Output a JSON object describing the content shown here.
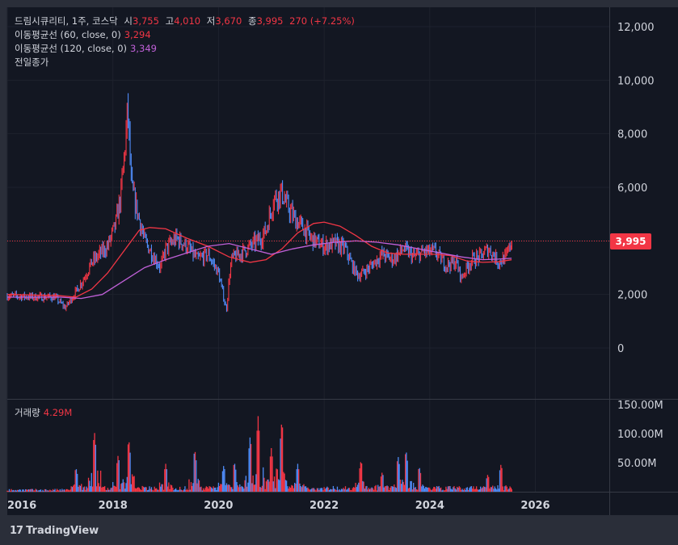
{
  "header": {
    "name": "드림시큐리티, 1주, 코스닥",
    "open_label": "시",
    "open": "3,755",
    "high_label": "고",
    "high": "4,010",
    "low_label": "저",
    "low": "3,670",
    "close_label": "종",
    "close": "3,995",
    "change": "270 (+7.25%)"
  },
  "ma60": {
    "label": "이동평균선 (60, close, 0)",
    "value": "3,294"
  },
  "ma120": {
    "label": "이동평균선 (120, close, 0)",
    "value": "3,349"
  },
  "prev_close_label": "전일종가",
  "last_price_tag": "3,995",
  "volume": {
    "label": "거래량",
    "value": "4.29M"
  },
  "branding": {
    "logo": "17",
    "name": "TradingView"
  },
  "colors": {
    "up": "#f23645",
    "down": "#2962ff",
    "ma60": "#f23645",
    "ma120": "#c060d8",
    "background": "#131722"
  },
  "chart_data": {
    "type": "line",
    "title": "드림시큐리티, 1주, 코스닥",
    "price_axis": {
      "ticks": [
        "12,000",
        "10,000",
        "8,000",
        "6,000",
        "4,000",
        "2,000",
        "0"
      ],
      "ylim": [
        -1000,
        12300
      ]
    },
    "volume_axis": {
      "ticks": [
        "150.00M",
        "100.00M",
        "50.00M"
      ],
      "ylim": [
        0,
        155
      ]
    },
    "x_axis": {
      "ticks": [
        "2016",
        "2018",
        "2020",
        "2022",
        "2024",
        "2026"
      ],
      "xlim": [
        2016.0,
        2027.4
      ]
    },
    "price_series": {
      "name": "close",
      "x": [
        2016.0,
        2016.5,
        2016.9,
        2017.1,
        2017.2,
        2017.3,
        2017.45,
        2017.6,
        2017.75,
        2017.9,
        2018.05,
        2018.15,
        2018.25,
        2018.28,
        2018.35,
        2018.45,
        2018.6,
        2018.75,
        2018.9,
        2019.0,
        2019.2,
        2019.4,
        2019.6,
        2019.8,
        2020.0,
        2020.15,
        2020.2,
        2020.25,
        2020.3,
        2020.4,
        2020.6,
        2020.8,
        2020.9,
        2021.05,
        2021.2,
        2021.3,
        2021.45,
        2021.6,
        2021.75,
        2021.9,
        2022.0,
        2022.2,
        2022.4,
        2022.55,
        2022.65,
        2022.8,
        2022.9,
        2023.1,
        2023.3,
        2023.5,
        2023.7,
        2023.9,
        2024.1,
        2024.3,
        2024.5,
        2024.6,
        2024.7,
        2024.8,
        2024.95,
        2025.1,
        2025.2,
        2025.3,
        2025.45,
        2025.55
      ],
      "values": [
        1950,
        1900,
        1900,
        1500,
        1800,
        2100,
        2600,
        3200,
        3500,
        3800,
        4600,
        5700,
        8000,
        9000,
        6000,
        5200,
        4000,
        3500,
        3000,
        3700,
        4100,
        3800,
        3300,
        3500,
        2800,
        1400,
        2600,
        3300,
        3400,
        3500,
        3800,
        4100,
        4400,
        5600,
        5800,
        5300,
        4800,
        4500,
        4100,
        3900,
        3800,
        3900,
        3700,
        3000,
        2700,
        2900,
        3100,
        3500,
        3300,
        3700,
        3400,
        3600,
        3600,
        3100,
        3200,
        2600,
        3000,
        3300,
        3400,
        3700,
        3500,
        3200,
        3400,
        3995
      ]
    },
    "ma60_series": {
      "name": "이동평균선 (60, close, 0)",
      "x": [
        2016.0,
        2017.0,
        2017.3,
        2017.6,
        2017.9,
        2018.2,
        2018.5,
        2018.7,
        2019.0,
        2019.4,
        2019.8,
        2020.2,
        2020.6,
        2020.9,
        2021.2,
        2021.5,
        2021.8,
        2022.0,
        2022.3,
        2022.6,
        2022.9,
        2023.2,
        2023.5,
        2023.8,
        2024.1,
        2024.4,
        2024.7,
        2025.0,
        2025.3,
        2025.55
      ],
      "values": [
        2000,
        1950,
        1900,
        2200,
        2800,
        3600,
        4400,
        4500,
        4450,
        4100,
        3800,
        3400,
        3200,
        3300,
        3700,
        4300,
        4650,
        4700,
        4550,
        4200,
        3800,
        3550,
        3500,
        3500,
        3500,
        3450,
        3250,
        3200,
        3220,
        3294
      ]
    },
    "ma120_series": {
      "name": "이동평균선 (120, close, 0)",
      "x": [
        2016.0,
        2017.0,
        2017.4,
        2017.8,
        2018.2,
        2018.6,
        2019.0,
        2019.4,
        2019.8,
        2020.2,
        2020.6,
        2021.0,
        2021.4,
        2021.8,
        2022.2,
        2022.6,
        2023.0,
        2023.4,
        2023.8,
        2024.2,
        2024.6,
        2025.0,
        2025.3,
        2025.55
      ],
      "values": [
        1900,
        1900,
        1850,
        2000,
        2500,
        3000,
        3300,
        3550,
        3800,
        3900,
        3700,
        3500,
        3700,
        3850,
        3950,
        4000,
        3950,
        3850,
        3700,
        3550,
        3400,
        3300,
        3320,
        3349
      ]
    },
    "volume_series": {
      "name": "거래량",
      "peaks_x": [
        2017.3,
        2017.65,
        2018.1,
        2018.3,
        2019.0,
        2019.55,
        2020.1,
        2020.3,
        2020.6,
        2020.75,
        2021.0,
        2021.2,
        2021.5,
        2022.7,
        2023.1,
        2023.4,
        2023.55,
        2023.8,
        2025.1,
        2025.35
      ],
      "peaks_values": [
        42,
        105,
        64,
        92,
        48,
        74,
        46,
        52,
        97,
        130,
        75,
        125,
        48,
        55,
        34,
        62,
        73,
        44,
        30,
        48
      ],
      "last_value": 4.29
    }
  }
}
